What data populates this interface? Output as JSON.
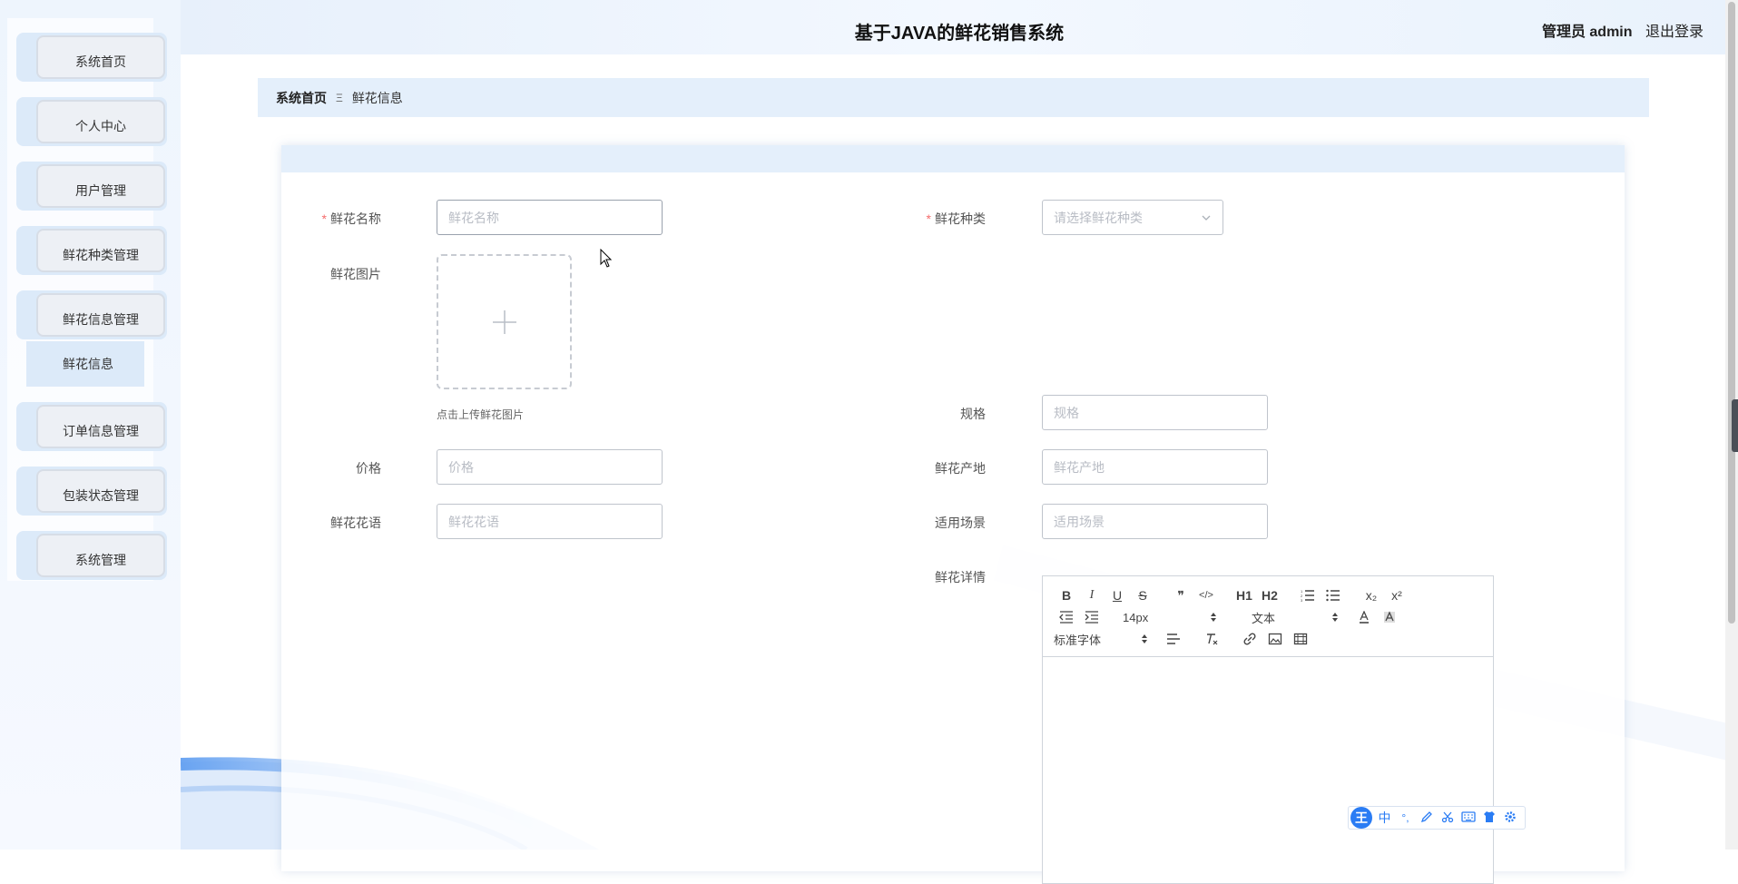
{
  "app": {
    "title": "基于JAVA的鲜花销售系统"
  },
  "user": {
    "role_name": "管理员 admin",
    "logout": "退出登录"
  },
  "sidebar": {
    "items": [
      {
        "label": "系统首页"
      },
      {
        "label": "个人中心"
      },
      {
        "label": "用户管理"
      },
      {
        "label": "鲜花种类管理"
      },
      {
        "label": "鲜花信息管理"
      },
      {
        "label": "订单信息管理"
      },
      {
        "label": "包装状态管理"
      },
      {
        "label": "系统管理"
      }
    ],
    "submenu": {
      "label": "鲜花信息"
    }
  },
  "breadcrumb": {
    "home": "系统首页",
    "separator": "Ξ",
    "current": "鲜花信息"
  },
  "form": {
    "name": {
      "label": "鲜花名称",
      "placeholder": "鲜花名称"
    },
    "type": {
      "label": "鲜花种类",
      "placeholder": "请选择鲜花种类"
    },
    "image": {
      "label": "鲜花图片",
      "hint": "点击上传鲜花图片"
    },
    "spec": {
      "label": "规格",
      "placeholder": "规格"
    },
    "price": {
      "label": "价格",
      "placeholder": "价格"
    },
    "origin": {
      "label": "鲜花产地",
      "placeholder": "鲜花产地"
    },
    "language": {
      "label": "鲜花花语",
      "placeholder": "鲜花花语"
    },
    "scene": {
      "label": "适用场景",
      "placeholder": "适用场景"
    },
    "detail": {
      "label": "鲜花详情"
    },
    "required_mark": "*"
  },
  "editor": {
    "row1": {
      "bold": "B",
      "italic": "I",
      "underline": "U",
      "strike": "S",
      "quote": "❞",
      "code": "</>",
      "h1": "H1",
      "h2": "H2",
      "sub": "x₂",
      "sup": "x²"
    },
    "font_size": "14px",
    "header_type": "文本",
    "font_family": "标准字体"
  },
  "ime": {
    "logo": "王",
    "lang": "中",
    "punct": "°,"
  },
  "colors": {
    "accent": "#2a7cf4",
    "required": "#f56c6c",
    "panel": "#e4effb"
  }
}
